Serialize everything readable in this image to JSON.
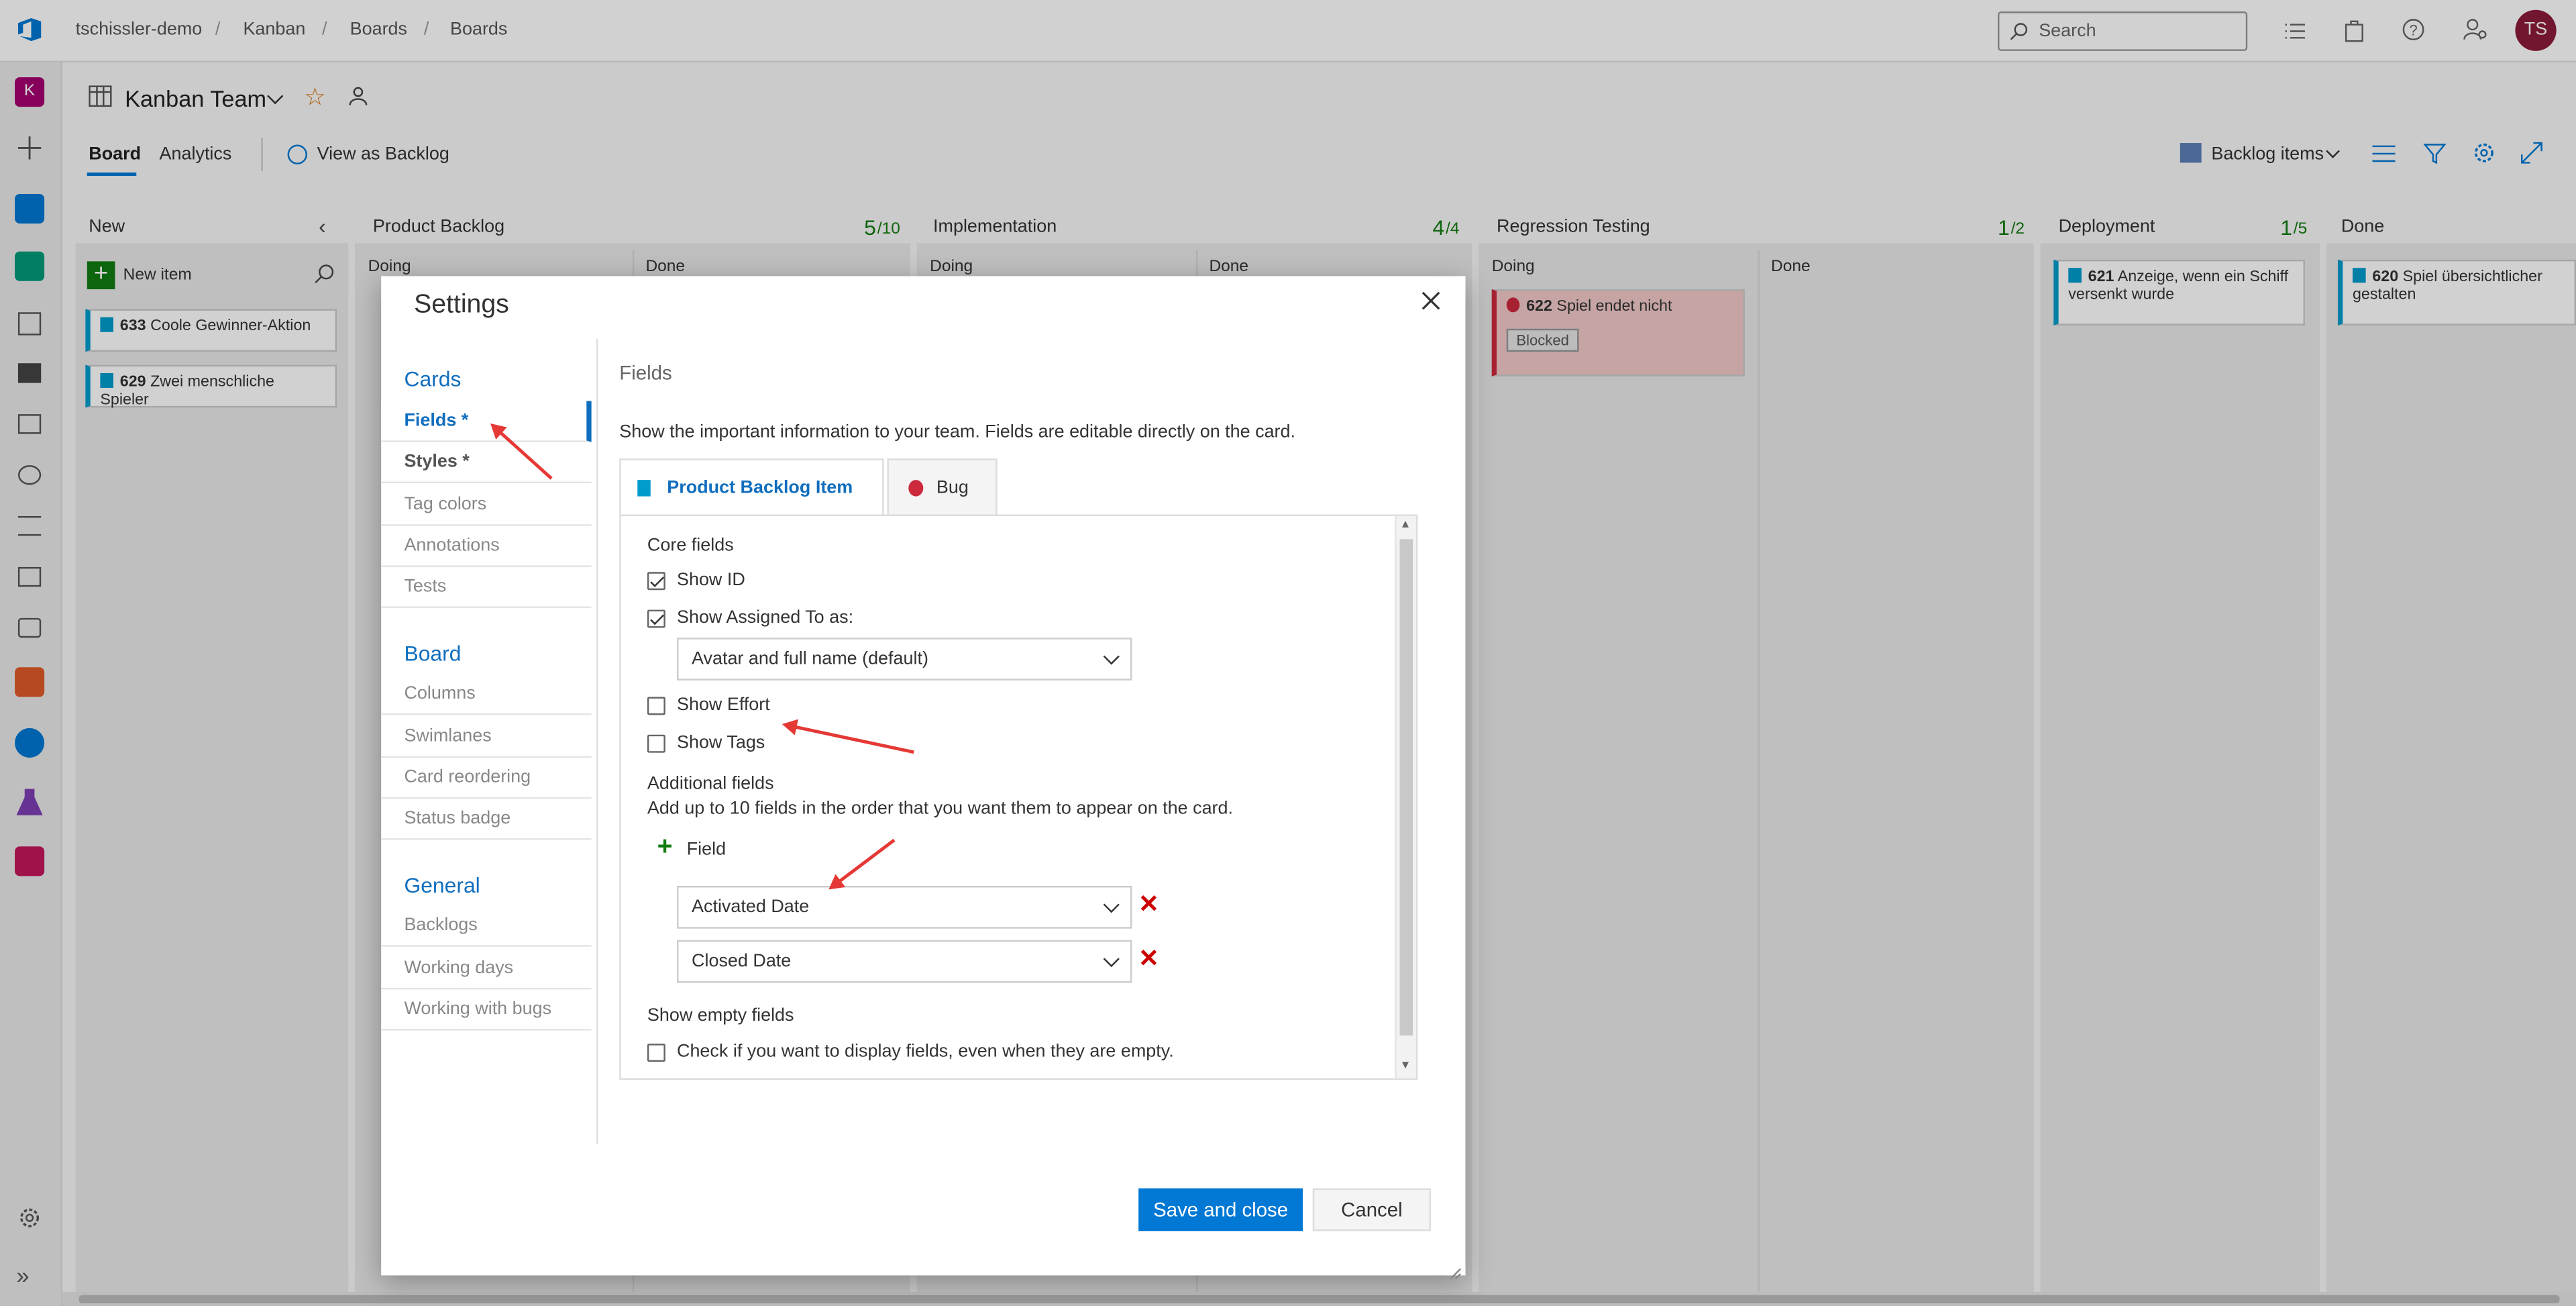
{
  "breadcrumb": [
    "tschissler-demo",
    "Kanban",
    "Boards",
    "Boards"
  ],
  "search_placeholder": "Search",
  "user_initials": "TS",
  "project_initial": "K",
  "team": {
    "name": "Kanban Team"
  },
  "tabs": {
    "board": "Board",
    "analytics": "Analytics",
    "view_backlog": "View as Backlog"
  },
  "backlog_selector": "Backlog items",
  "columns": {
    "new": {
      "title": "New",
      "new_item": "New item"
    },
    "product_backlog": {
      "title": "Product Backlog",
      "count": "5",
      "limit": "/10",
      "doing": "Doing",
      "done": "Done"
    },
    "implementation": {
      "title": "Implementation",
      "count": "4",
      "limit": "/4",
      "doing": "Doing",
      "done": "Done"
    },
    "regression": {
      "title": "Regression Testing",
      "count": "1",
      "limit": "/2",
      "doing": "Doing",
      "done": "Done"
    },
    "deployment": {
      "title": "Deployment",
      "count": "1",
      "limit": "/5"
    },
    "done": {
      "title": "Done"
    }
  },
  "cards": {
    "c633": {
      "id": "633",
      "title": "Coole Gewinner-Aktion"
    },
    "c629": {
      "id": "629",
      "title": "Zwei menschliche Spieler"
    },
    "c622": {
      "id": "622",
      "title": "Spiel endet nicht",
      "tag": "Blocked"
    },
    "c621": {
      "id": "621",
      "title": "Anzeige, wenn ein Schiff versenkt wurde"
    },
    "c620": {
      "id": "620",
      "title": "Spiel übersichtlicher gestalten"
    }
  },
  "dialog": {
    "title": "Settings",
    "nav": {
      "cards_header": "Cards",
      "fields": "Fields *",
      "styles": "Styles *",
      "tag_colors": "Tag colors",
      "annotations": "Annotations",
      "tests": "Tests",
      "board_header": "Board",
      "columns": "Columns",
      "swimlanes": "Swimlanes",
      "card_reordering": "Card reordering",
      "status_badge": "Status badge",
      "general_header": "General",
      "backlogs": "Backlogs",
      "working_days": "Working days",
      "working_with_bugs": "Working with bugs"
    },
    "section_title": "Fields",
    "description": "Show the important information to your team. Fields are editable directly on the card.",
    "type_tabs": {
      "pbi": "Product Backlog Item",
      "bug": "Bug"
    },
    "core_fields": "Core fields",
    "show_id": "Show ID",
    "show_assigned": "Show Assigned To as:",
    "assigned_option": "Avatar and full name (default)",
    "show_effort": "Show Effort",
    "show_tags": "Show Tags",
    "additional_fields": "Additional fields",
    "additional_desc": "Add up to 10 fields in the order that you want them to appear on the card.",
    "add_field": "Field",
    "field1": "Activated Date",
    "field2": "Closed Date",
    "show_empty": "Show empty fields",
    "show_empty_desc": "Check if you want to display fields, even when they are empty.",
    "save": "Save and close",
    "cancel": "Cancel",
    "checks": {
      "show_id": true,
      "show_assigned": true,
      "show_effort": false,
      "show_tags": false,
      "show_empty": false
    }
  }
}
